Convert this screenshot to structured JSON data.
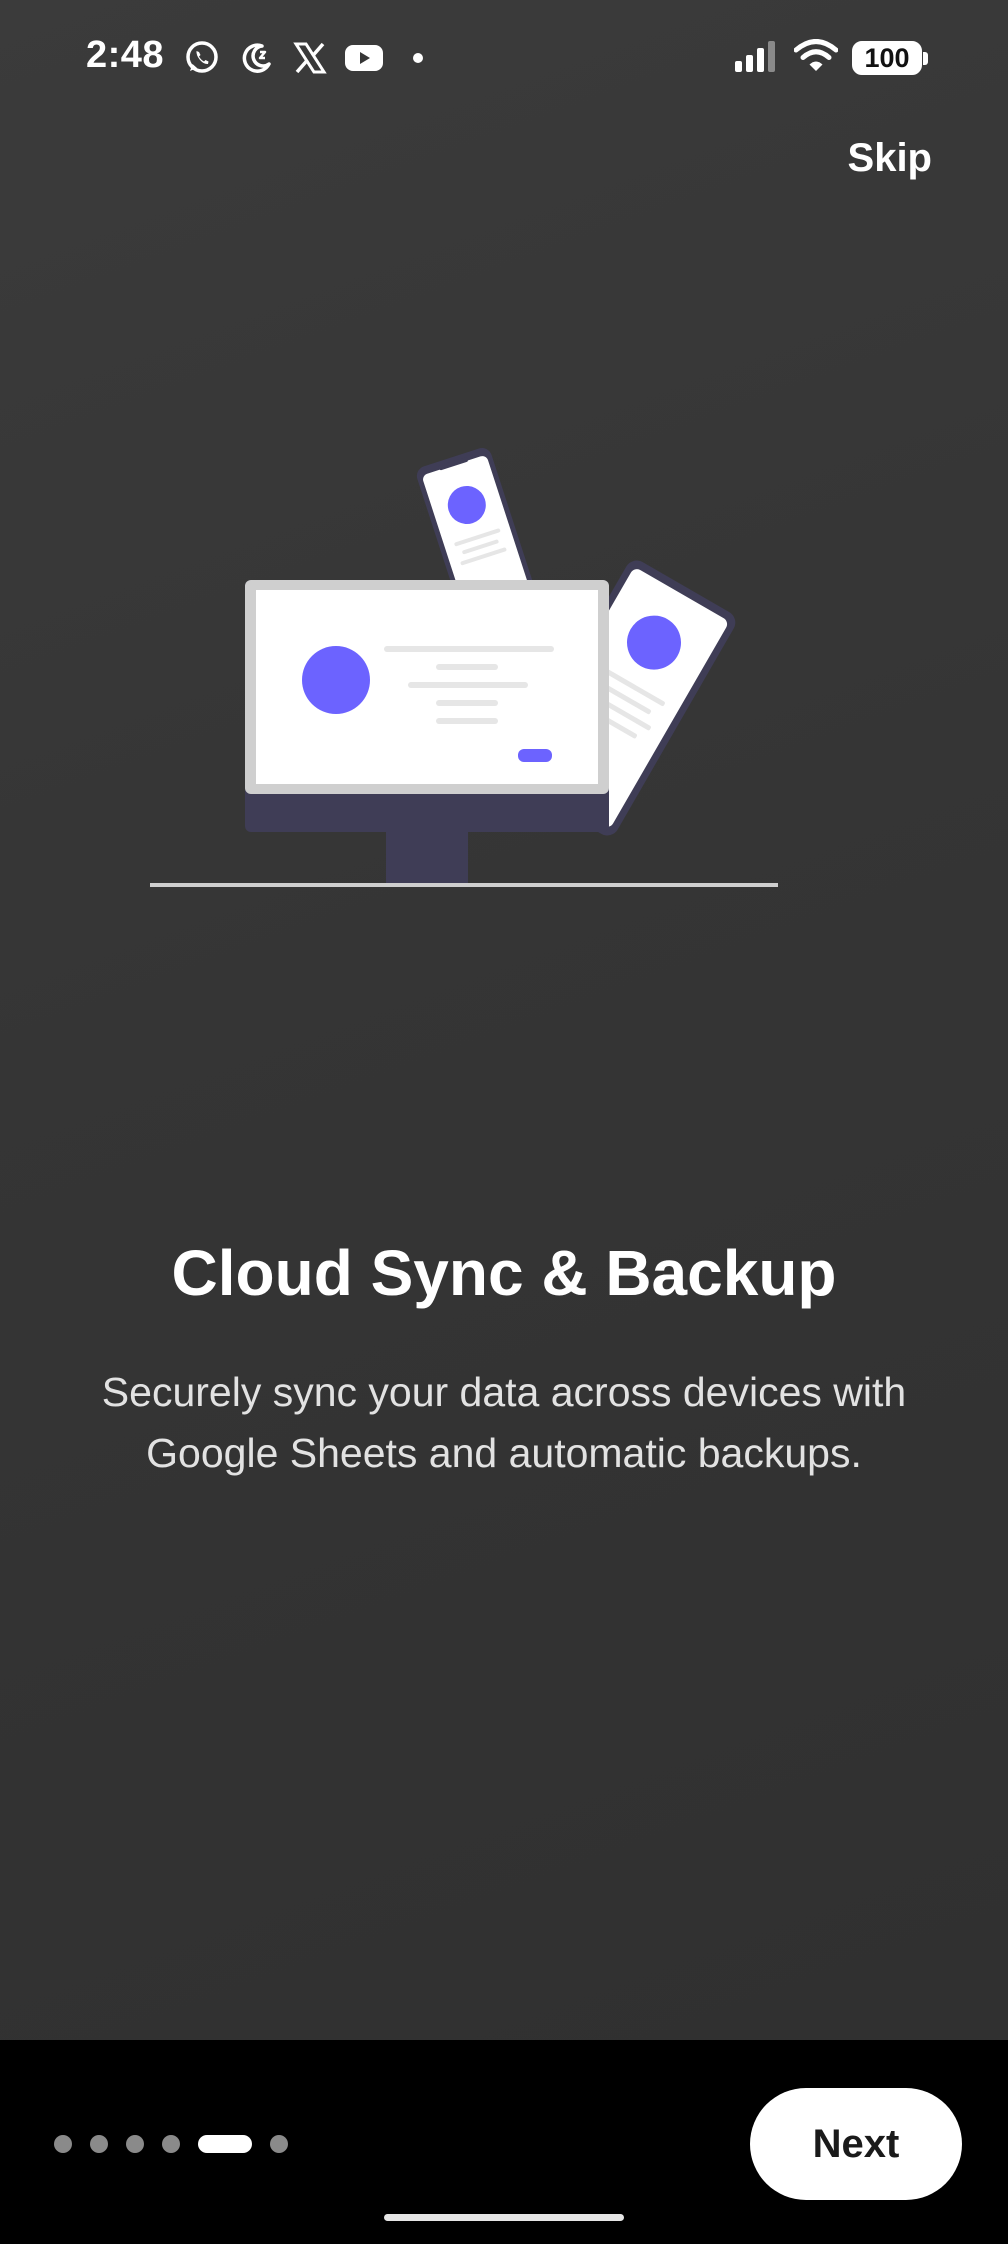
{
  "status_bar": {
    "time": "2:48",
    "left_icons": [
      "whatsapp-icon",
      "moon-icon",
      "x-icon",
      "youtube-icon",
      "dot-icon"
    ],
    "battery": "100"
  },
  "header": {
    "skip_label": "Skip"
  },
  "onboarding": {
    "title": "Cloud Sync & Backup",
    "description": "Securely sync your data across devices with Google Sheets and automatic backups."
  },
  "pager": {
    "total_pages": 6,
    "current_page": 5
  },
  "footer": {
    "next_label": "Next"
  },
  "colors": {
    "accent": "#6c63ff",
    "background": "#363636",
    "bottom_bar": "#000000",
    "device_dark": "#3f3d56"
  }
}
